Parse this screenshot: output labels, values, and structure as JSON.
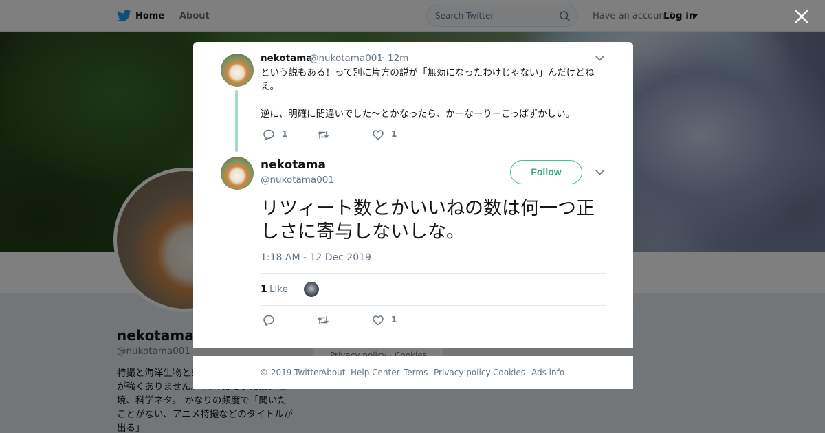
{
  "nav": {
    "home_label": "Home",
    "about_label": "About",
    "search_placeholder": "Search Twitter",
    "have_account": "Have an account?",
    "login_label": "Log in"
  },
  "profile": {
    "name": "nekotama",
    "handle": "@nukotama001",
    "bio": "特撮と海洋生物とぬるい動物ガチ勢かで気が強くありません。 時々ぬるい政治、環境、科学ネタ。 かなりの頻度で「聞いたことがない、アニメ特撮などのタイトルが出る」",
    "footer_links": "Privacy policy · Cookies"
  },
  "parent_tweet": {
    "name": "nekotama",
    "handle": "@nukotama001",
    "separator": "·",
    "time": "12m",
    "text_p1": "という説もある！って別に片方の説が「無効になったわけじゃない」んだけどねえ。",
    "text_p2": "逆に、明確に間違いでした～とかなったら、かーなーりーこっぱずかしい。",
    "reply_count": "1",
    "retweet_count": "",
    "like_count": "1"
  },
  "main_tweet": {
    "name": "nekotama",
    "handle": "@nukotama001",
    "follow_label": "Follow",
    "text": "リツィート数とかいいねの数は何一つ正しさに寄与しないしな。",
    "date": "1:18 AM - 12 Dec 2019",
    "likes_number": "1",
    "likes_label": "Like",
    "reply_count": "",
    "retweet_count": "",
    "like_count": "1"
  },
  "footer": {
    "copyright": "© 2019 Twitter",
    "about": "About",
    "help": "Help Center",
    "terms": "Terms",
    "privacy": "Privacy policy",
    "cookies": "Cookies",
    "ads": "Ads info"
  },
  "colors": {
    "brand_blue": "#1da1f2",
    "follow_green": "#3aa97b",
    "thread_line": "#9fdcc0",
    "muted_text": "#657786",
    "overlay": "rgba(0,0,0,0.5)"
  },
  "icons": [
    "twitter-bird-icon",
    "search-icon",
    "close-icon",
    "chevron-down-icon",
    "reply-icon",
    "retweet-icon",
    "heart-icon"
  ]
}
